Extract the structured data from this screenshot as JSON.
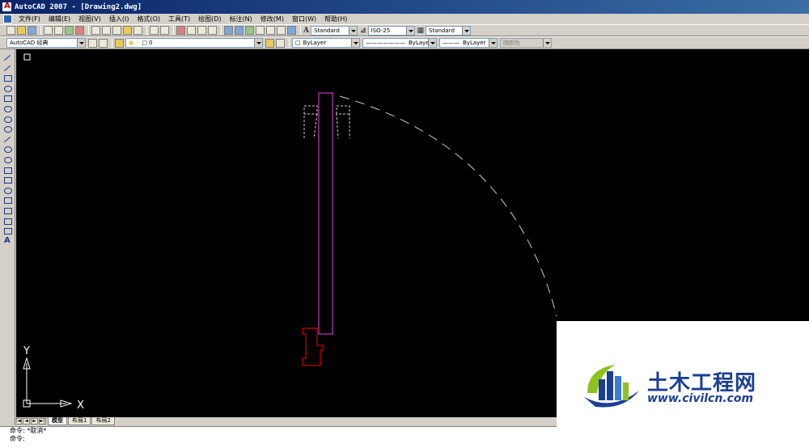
{
  "window": {
    "title": "AutoCAD 2007 - [Drawing2.dwg]"
  },
  "menu": [
    "文件(F)",
    "编辑(E)",
    "视图(V)",
    "插入(I)",
    "格式(O)",
    "工具(T)",
    "绘图(D)",
    "标注(N)",
    "修改(M)",
    "窗口(W)",
    "帮助(H)"
  ],
  "toolbar": {
    "text_style": "Standard",
    "dim_style": "ISO-25",
    "table_style": "Standard",
    "workspace": "AutoCAD 经典",
    "layer": "0",
    "color": "ByLayer",
    "linetype": "ByLayer",
    "lineweight": "ByLayer",
    "plot_style": "随颜色"
  },
  "canvas": {
    "background": "#000000",
    "ucs": {
      "x_label": "X",
      "y_label": "Y"
    }
  },
  "layout_tabs": [
    "模型",
    "布局1",
    "布局2"
  ],
  "command": {
    "line1": "命令: *取消*",
    "line2": "命令:"
  },
  "watermark": {
    "cn_text": "土木工程网",
    "url": "www.civilcn.com"
  },
  "colors": {
    "magenta": "#cc33cc",
    "red": "#cc0000",
    "dashed": "#cccccc",
    "brand_blue": "#1b3f92"
  },
  "draw_tools": [
    "line-icon",
    "construction-line-icon",
    "polyline-icon",
    "polygon-icon",
    "rectangle-icon",
    "arc-icon",
    "circle-icon",
    "revision-cloud-icon",
    "spline-icon",
    "ellipse-icon",
    "ellipse-arc-icon",
    "insert-block-icon",
    "make-block-icon",
    "point-icon",
    "hatch-icon",
    "gradient-icon",
    "region-icon",
    "table-icon",
    "multiline-text-icon"
  ]
}
